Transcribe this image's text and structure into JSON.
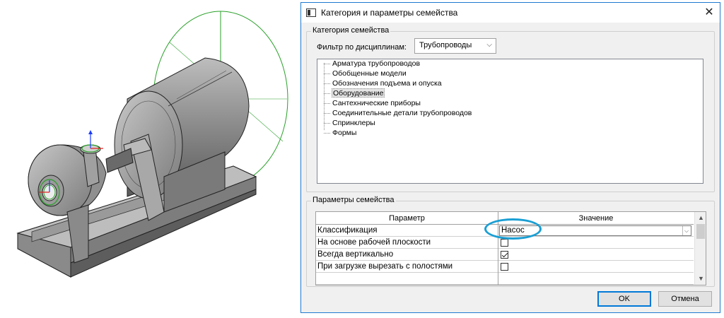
{
  "dialog": {
    "title": "Категория и параметры семейства",
    "close_symbol": "✕",
    "accent_color": "#0078d7"
  },
  "category_group": {
    "legend": "Категория семейства",
    "filter_label": "Фильтр по дисциплинам:",
    "filter_value": "Трубопроводы",
    "items": [
      "Арматура трубопроводов",
      "Обобщенные модели",
      "Обозначения подъема и опуска",
      "Оборудование",
      "Сантехнические приборы",
      "Соединительные детали трубопроводов",
      "Спринклеры",
      "Формы"
    ],
    "selected_item": "Оборудование"
  },
  "params_group": {
    "legend": "Параметры семейства",
    "col_param": "Параметр",
    "col_value": "Значение",
    "rows": [
      {
        "name": "Классификация",
        "type": "combo",
        "value": "Насос"
      },
      {
        "name": "На основе рабочей плоскости",
        "type": "checkbox",
        "checked": false
      },
      {
        "name": "Всегда вертикально",
        "type": "checkbox",
        "checked": true
      },
      {
        "name": "При загрузке вырезать с полостями",
        "type": "checkbox",
        "checked": false
      }
    ],
    "highlight_color": "#1a9fd4"
  },
  "buttons": {
    "ok": "OK",
    "cancel": "Отмена"
  },
  "icons": {
    "app": "family-editor-icon",
    "close": "close-icon",
    "dropdown": "chevron-down-icon",
    "scroll_up": "scroll-up-icon",
    "scroll_down": "scroll-down-icon"
  }
}
